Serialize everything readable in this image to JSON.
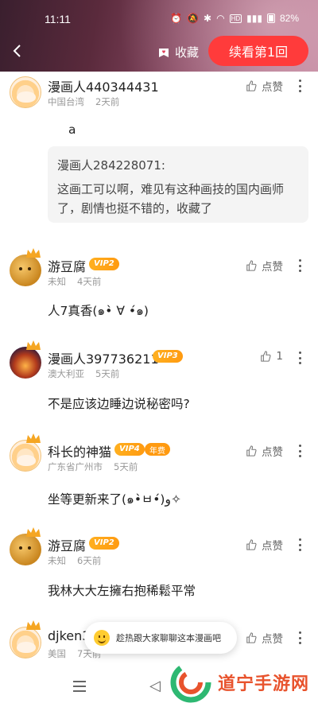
{
  "status_bar": {
    "time": "11:11",
    "icons": [
      "alarm-icon",
      "mute-icon",
      "bluetooth-icon",
      "wifi-icon",
      "hd-icon",
      "signal-icon"
    ],
    "battery": "82%"
  },
  "header": {
    "favorite_label": "收藏",
    "continue_label": "续看第1回",
    "accent_color": "#ff3b3b"
  },
  "comments": [
    {
      "name": "漫画人440344431",
      "location": "中国台湾",
      "time": "2天前",
      "like_label": "点赞",
      "text": "a",
      "quote_author": "漫画人284228071:",
      "quote_line1": "这画工可以啊，难见有这种画技的国内画师",
      "quote_line2": "了，剧情也挺不错的，收藏了"
    },
    {
      "name": "游豆腐",
      "vip": "VIP2",
      "location": "未知",
      "time": "4天前",
      "like_label": "点赞",
      "text": "人7真香(๑•̀ ∀ •́๑)"
    },
    {
      "name": "漫画人397736211",
      "vip": "VIP3",
      "location": "澳大利亚",
      "time": "5天前",
      "like_label": "1",
      "text": "不是应该边睡边说秘密吗?"
    },
    {
      "name": "科长的神猫",
      "vip": "VIP4",
      "annual": "年费",
      "location": "广东省广州市",
      "time": "5天前",
      "like_label": "点赞",
      "text": "坐等更新来了(๑•̀ㅂ•́)و✧"
    },
    {
      "name": "游豆腐",
      "vip": "VIP2",
      "location": "未知",
      "time": "6天前",
      "like_label": "点赞",
      "text": "我林大大左擁右抱稀鬆平常"
    },
    {
      "name": "djken3",
      "location": "美国",
      "time": "7天前",
      "like_label": "点赞"
    }
  ],
  "toast": {
    "text": "趁热跟大家聊聊这本漫画吧"
  },
  "watermark": {
    "text": "道宁手游网"
  }
}
